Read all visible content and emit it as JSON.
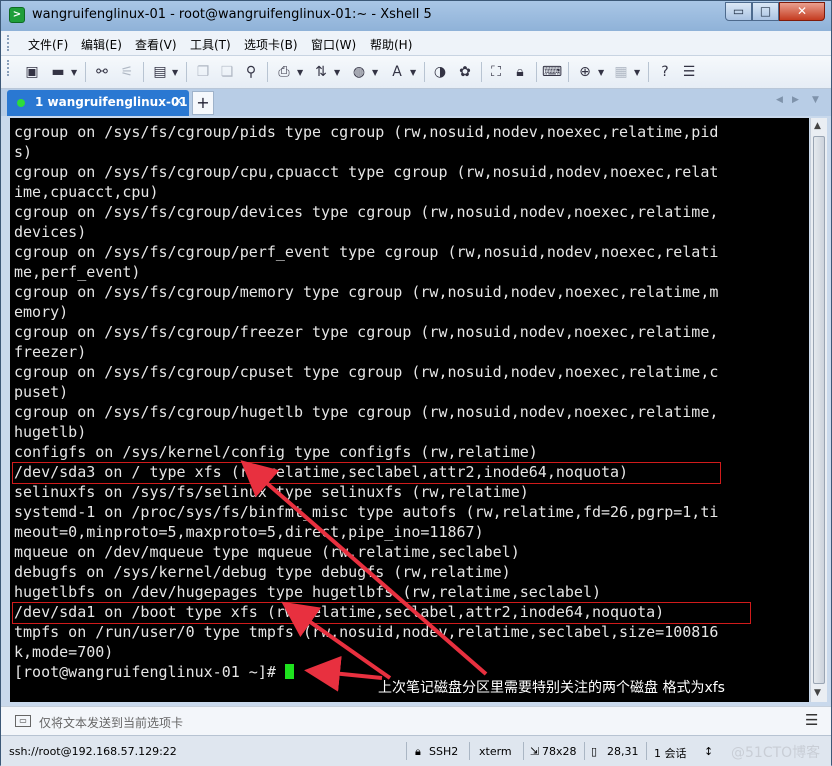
{
  "window": {
    "title": "wangruifenglinux-01 - root@wangruifenglinux-01:~ - Xshell 5",
    "controls": {
      "minimize": "▭",
      "maximize": "□",
      "close": "✕"
    }
  },
  "menu": [
    "文件(F)",
    "编辑(E)",
    "查看(V)",
    "工具(T)",
    "选项卡(B)",
    "窗口(W)",
    "帮助(H)"
  ],
  "tab": {
    "label": "1 wangruifenglinux-01",
    "close": "×",
    "add": "+"
  },
  "terminal": {
    "lines": [
      "cgroup on /sys/fs/cgroup/pids type cgroup (rw,nosuid,nodev,noexec,relatime,pid",
      "s)",
      "cgroup on /sys/fs/cgroup/cpu,cpuacct type cgroup (rw,nosuid,nodev,noexec,relat",
      "ime,cpuacct,cpu)",
      "cgroup on /sys/fs/cgroup/devices type cgroup (rw,nosuid,nodev,noexec,relatime,",
      "devices)",
      "cgroup on /sys/fs/cgroup/perf_event type cgroup (rw,nosuid,nodev,noexec,relati",
      "me,perf_event)",
      "cgroup on /sys/fs/cgroup/memory type cgroup (rw,nosuid,nodev,noexec,relatime,m",
      "emory)",
      "cgroup on /sys/fs/cgroup/freezer type cgroup (rw,nosuid,nodev,noexec,relatime,",
      "freezer)",
      "cgroup on /sys/fs/cgroup/cpuset type cgroup (rw,nosuid,nodev,noexec,relatime,c",
      "puset)",
      "cgroup on /sys/fs/cgroup/hugetlb type cgroup (rw,nosuid,nodev,noexec,relatime,",
      "hugetlb)",
      "configfs on /sys/kernel/config type configfs (rw,relatime)",
      "/dev/sda3 on / type xfs (rw,relatime,seclabel,attr2,inode64,noquota)",
      "selinuxfs on /sys/fs/selinux type selinuxfs (rw,relatime)",
      "systemd-1 on /proc/sys/fs/binfmt_misc type autofs (rw,relatime,fd=26,pgrp=1,ti",
      "meout=0,minproto=5,maxproto=5,direct,pipe_ino=11867)",
      "mqueue on /dev/mqueue type mqueue (rw,relatime,seclabel)",
      "debugfs on /sys/kernel/debug type debugfs (rw,relatime)",
      "hugetlbfs on /dev/hugepages type hugetlbfs (rw,relatime,seclabel)",
      "/dev/sda1 on /boot type xfs (rw,relatime,seclabel,attr2,inode64,noquota)",
      "tmpfs on /run/user/0 type tmpfs (rw,nosuid,nodev,relatime,seclabel,size=100816",
      "k,mode=700)"
    ],
    "prompt": "[root@wangruifenglinux-01 ~]# "
  },
  "annotation": {
    "text": "上次笔记磁盘分区里需要特别关注的两个磁盘 格式为xfs",
    "color": "#e8303f"
  },
  "send_bar": {
    "placeholder": "仅将文本发送到当前选项卡"
  },
  "status": {
    "connection": "ssh://root@192.168.57.129:22",
    "protocol": "SSH2",
    "term_type": "xterm",
    "size": "78x28",
    "cursor_pos": "28,31",
    "sessions": "1 会话",
    "watermark": "@51CTO博客"
  },
  "colors": {
    "terminal_bg": "#000000",
    "terminal_fg": "#e6e6e6",
    "cursor": "#1ee21e",
    "highlight_box": "#d11b1b",
    "tab_active": "#2a78d2"
  }
}
